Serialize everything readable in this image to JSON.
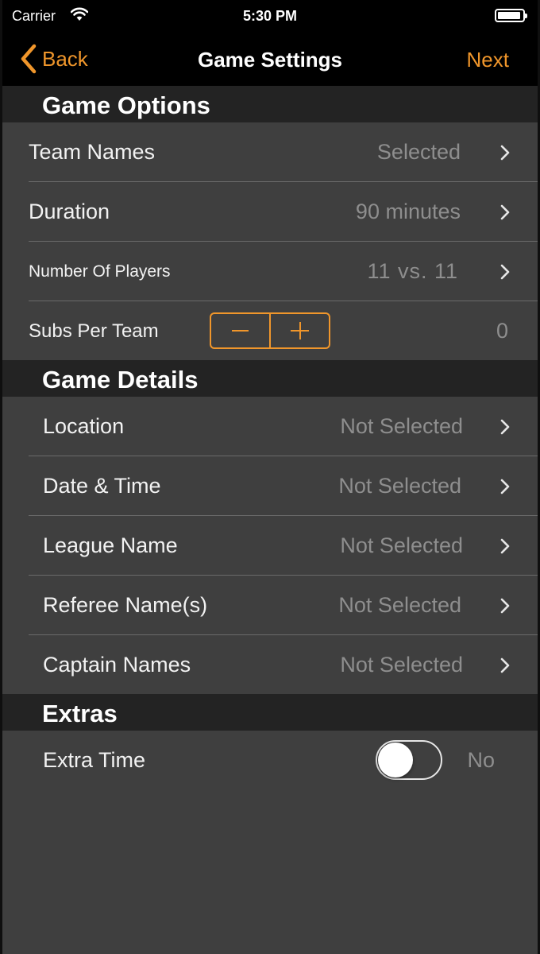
{
  "status_bar": {
    "carrier": "Carrier",
    "time": "5:30 PM"
  },
  "nav": {
    "back_label": "Back",
    "title": "Game Settings",
    "next_label": "Next"
  },
  "game_options": {
    "header": "Game Options",
    "team_names": {
      "label": "Team Names",
      "value": "Selected"
    },
    "duration": {
      "label": "Duration",
      "value": "90 minutes"
    },
    "players": {
      "label": "Number Of Players",
      "value": "11 vs. 11"
    },
    "subs": {
      "label": "Subs Per Team",
      "value": "0"
    }
  },
  "game_details": {
    "header": "Game Details",
    "location": {
      "label": "Location",
      "value": "Not Selected"
    },
    "datetime": {
      "label": "Date & Time",
      "value": "Not Selected"
    },
    "league": {
      "label": "League Name",
      "value": "Not Selected"
    },
    "referee": {
      "label": "Referee Name(s)",
      "value": "Not Selected"
    },
    "captain": {
      "label": "Captain Names",
      "value": "Not Selected"
    }
  },
  "extras": {
    "header": "Extras",
    "extra_time": {
      "label": "Extra Time",
      "state": "No",
      "enabled": false
    }
  },
  "colors": {
    "accent": "#f0962b",
    "background": "#3f3f3f",
    "header": "#232323",
    "value_text": "#8e8e8e"
  },
  "icons": [
    "wifi-icon",
    "battery-icon",
    "back-chevron-icon",
    "chevron-right-icon",
    "minus-icon",
    "plus-icon"
  ]
}
